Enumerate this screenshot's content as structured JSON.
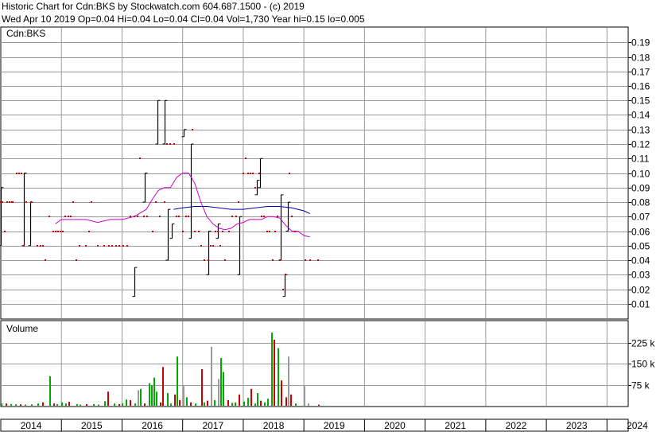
{
  "header": {
    "line1": "Historic Chart for Cdn:BKS by Stockwatch.com 604.687.1500 - (c) 2019",
    "line2": "Wed Apr 10 2019  Op=0.04  Hi=0.04  Lo=0.04  Cl=0.04  Vol=1,730  Year hi=0.15  lo=0.005"
  },
  "chart_data": [
    {
      "type": "ohlc",
      "title": "Cdn:BKS",
      "ylim": [
        0,
        0.2
      ],
      "y_ticks": [
        "0.19",
        "0.18",
        "0.17",
        "0.16",
        "0.15",
        "0.14",
        "0.13",
        "0.12",
        "0.11",
        "0.10",
        "0.09",
        "0.08",
        "0.07",
        "0.06",
        "0.05",
        "0.04",
        "0.03",
        "0.02",
        "0.01"
      ],
      "grid": true,
      "colors": {
        "price": "#cc0000",
        "bar": "#000000",
        "ma_short": "#cc00cc",
        "ma_long": "#0000aa",
        "grid": "#999999"
      },
      "price_points": [
        [
          2014.0,
          0.08
        ],
        [
          2014.02,
          0.08
        ],
        [
          2014.06,
          0.06
        ],
        [
          2014.1,
          0.08
        ],
        [
          2014.14,
          0.08
        ],
        [
          2014.18,
          0.08
        ],
        [
          2014.2,
          0.08
        ],
        [
          2014.26,
          0.1
        ],
        [
          2014.3,
          0.1
        ],
        [
          2014.34,
          0.1
        ],
        [
          2014.38,
          0.05
        ],
        [
          2014.42,
          0.08
        ],
        [
          2014.5,
          0.08
        ],
        [
          2014.6,
          0.05
        ],
        [
          2014.66,
          0.05
        ],
        [
          2014.7,
          0.05
        ],
        [
          2014.74,
          0.04
        ],
        [
          2014.8,
          0.07
        ],
        [
          2014.86,
          0.06
        ],
        [
          2014.9,
          0.06
        ],
        [
          2014.94,
          0.06
        ],
        [
          2014.98,
          0.06
        ],
        [
          2015.02,
          0.06
        ],
        [
          2015.06,
          0.07
        ],
        [
          2015.12,
          0.07
        ],
        [
          2015.16,
          0.07
        ],
        [
          2015.2,
          0.08
        ],
        [
          2015.24,
          0.04
        ],
        [
          2015.3,
          0.05
        ],
        [
          2015.4,
          0.05
        ],
        [
          2015.46,
          0.06
        ],
        [
          2015.5,
          0.08
        ],
        [
          2015.6,
          0.05
        ],
        [
          2015.7,
          0.05
        ],
        [
          2015.78,
          0.05
        ],
        [
          2015.84,
          0.05
        ],
        [
          2015.9,
          0.05
        ],
        [
          2015.96,
          0.05
        ],
        [
          2016.02,
          0.05
        ],
        [
          2016.08,
          0.05
        ],
        [
          2016.14,
          0.07
        ],
        [
          2016.2,
          0.07
        ],
        [
          2016.26,
          0.07
        ],
        [
          2016.3,
          0.11
        ],
        [
          2016.36,
          0.07
        ],
        [
          2016.42,
          0.07
        ],
        [
          2016.5,
          0.06
        ],
        [
          2016.56,
          0.08
        ],
        [
          2016.62,
          0.07
        ],
        [
          2016.7,
          0.08
        ],
        [
          2016.74,
          0.12
        ],
        [
          2016.8,
          0.12
        ],
        [
          2016.86,
          0.12
        ],
        [
          2016.9,
          0.07
        ],
        [
          2016.94,
          0.07
        ],
        [
          2017.0,
          0.06
        ],
        [
          2017.06,
          0.07
        ],
        [
          2017.1,
          0.07
        ],
        [
          2017.16,
          0.13
        ],
        [
          2017.2,
          0.06
        ],
        [
          2017.26,
          0.06
        ],
        [
          2017.3,
          0.05
        ],
        [
          2017.36,
          0.04
        ],
        [
          2017.42,
          0.04
        ],
        [
          2017.46,
          0.05
        ],
        [
          2017.5,
          0.05
        ],
        [
          2017.54,
          0.06
        ],
        [
          2017.58,
          0.06
        ],
        [
          2017.62,
          0.05
        ],
        [
          2017.66,
          0.06
        ],
        [
          2017.7,
          0.04
        ],
        [
          2017.76,
          0.06
        ],
        [
          2017.82,
          0.07
        ],
        [
          2017.88,
          0.07
        ],
        [
          2017.92,
          0.08
        ],
        [
          2018.0,
          0.1
        ],
        [
          2018.04,
          0.11
        ],
        [
          2018.08,
          0.1
        ],
        [
          2018.12,
          0.1
        ],
        [
          2018.16,
          0.1
        ],
        [
          2018.2,
          0.09
        ],
        [
          2018.26,
          0.1
        ],
        [
          2018.3,
          0.07
        ],
        [
          2018.34,
          0.07
        ],
        [
          2018.4,
          0.06
        ],
        [
          2018.44,
          0.06
        ],
        [
          2018.48,
          0.04
        ],
        [
          2018.52,
          0.06
        ],
        [
          2018.56,
          0.07
        ],
        [
          2018.6,
          0.04
        ],
        [
          2018.66,
          0.02
        ],
        [
          2018.7,
          0.03
        ],
        [
          2018.76,
          0.1
        ],
        [
          2018.8,
          0.07
        ],
        [
          2018.86,
          0.06
        ],
        [
          2019.02,
          0.04
        ],
        [
          2019.1,
          0.04
        ],
        [
          2019.24,
          0.04
        ]
      ],
      "bars": [
        [
          2014.0,
          0.05,
          0.09
        ],
        [
          2014.38,
          0.05,
          0.1
        ],
        [
          2014.48,
          0.05,
          0.08
        ],
        [
          2016.2,
          0.015,
          0.035
        ],
        [
          2016.38,
          0.08,
          0.1
        ],
        [
          2016.58,
          0.12,
          0.15
        ],
        [
          2016.7,
          0.12,
          0.15
        ],
        [
          2016.76,
          0.04,
          0.075
        ],
        [
          2016.82,
          0.055,
          0.065
        ],
        [
          2017.02,
          0.125,
          0.13
        ],
        [
          2017.14,
          0.055,
          0.12
        ],
        [
          2017.42,
          0.03,
          0.06
        ],
        [
          2017.58,
          0.055,
          0.065
        ],
        [
          2017.94,
          0.03,
          0.07
        ],
        [
          2018.22,
          0.085,
          0.095
        ],
        [
          2018.28,
          0.09,
          0.11
        ],
        [
          2018.62,
          0.04,
          0.085
        ],
        [
          2018.68,
          0.015,
          0.03
        ],
        [
          2018.74,
          0.06,
          0.08
        ]
      ],
      "ma_short": [
        [
          2014.9,
          0.065
        ],
        [
          2015.0,
          0.068
        ],
        [
          2015.2,
          0.068
        ],
        [
          2015.4,
          0.068
        ],
        [
          2015.6,
          0.066
        ],
        [
          2015.8,
          0.068
        ],
        [
          2016.0,
          0.068
        ],
        [
          2016.2,
          0.07
        ],
        [
          2016.4,
          0.075
        ],
        [
          2016.5,
          0.082
        ],
        [
          2016.6,
          0.088
        ],
        [
          2016.7,
          0.09
        ],
        [
          2016.8,
          0.09
        ],
        [
          2016.9,
          0.097
        ],
        [
          2017.0,
          0.1
        ],
        [
          2017.1,
          0.1
        ],
        [
          2017.2,
          0.093
        ],
        [
          2017.3,
          0.08
        ],
        [
          2017.4,
          0.07
        ],
        [
          2017.5,
          0.065
        ],
        [
          2017.6,
          0.062
        ],
        [
          2017.7,
          0.061
        ],
        [
          2017.8,
          0.062
        ],
        [
          2017.9,
          0.065
        ],
        [
          2018.0,
          0.066
        ],
        [
          2018.1,
          0.068
        ],
        [
          2018.2,
          0.068
        ],
        [
          2018.3,
          0.068
        ],
        [
          2018.4,
          0.07
        ],
        [
          2018.5,
          0.07
        ],
        [
          2018.6,
          0.069
        ],
        [
          2018.7,
          0.064
        ],
        [
          2018.8,
          0.06
        ],
        [
          2018.9,
          0.06
        ],
        [
          2019.0,
          0.057
        ],
        [
          2019.1,
          0.056
        ]
      ],
      "ma_long": [
        [
          2016.85,
          0.075
        ],
        [
          2017.0,
          0.076
        ],
        [
          2017.2,
          0.077
        ],
        [
          2017.4,
          0.077
        ],
        [
          2017.6,
          0.076
        ],
        [
          2017.8,
          0.075
        ],
        [
          2018.0,
          0.075
        ],
        [
          2018.2,
          0.076
        ],
        [
          2018.4,
          0.077
        ],
        [
          2018.6,
          0.077
        ],
        [
          2018.8,
          0.076
        ],
        [
          2019.0,
          0.074
        ],
        [
          2019.1,
          0.072
        ]
      ]
    },
    {
      "type": "bar",
      "title": "Volume",
      "ylim": [
        0,
        300
      ],
      "y_ticks": [
        "225 k",
        "150 k",
        "75 k"
      ],
      "y_tick_values": [
        225,
        150,
        75
      ],
      "grid": true,
      "colors": {
        "up": "#00aa00",
        "down": "#cc0000",
        "flat": "#999999"
      },
      "bars": [
        [
          2014.0,
          8,
          "up"
        ],
        [
          2014.08,
          8,
          "down"
        ],
        [
          2014.16,
          6,
          "up"
        ],
        [
          2014.24,
          5,
          "up"
        ],
        [
          2014.32,
          5,
          "down"
        ],
        [
          2014.4,
          4,
          "up"
        ],
        [
          2014.5,
          5,
          "up"
        ],
        [
          2014.6,
          8,
          "up"
        ],
        [
          2014.68,
          12,
          "down"
        ],
        [
          2014.8,
          105,
          "up"
        ],
        [
          2014.86,
          8,
          "down"
        ],
        [
          2014.92,
          6,
          "up"
        ],
        [
          2015.0,
          12,
          "up"
        ],
        [
          2015.06,
          8,
          "up"
        ],
        [
          2015.12,
          14,
          "down"
        ],
        [
          2015.24,
          6,
          "up"
        ],
        [
          2015.3,
          4,
          "up"
        ],
        [
          2015.4,
          6,
          "down"
        ],
        [
          2015.52,
          6,
          "up"
        ],
        [
          2015.6,
          4,
          "up"
        ],
        [
          2015.7,
          16,
          "up"
        ],
        [
          2015.76,
          50,
          "down"
        ],
        [
          2015.86,
          8,
          "up"
        ],
        [
          2015.94,
          6,
          "down"
        ],
        [
          2016.0,
          8,
          "up"
        ],
        [
          2016.06,
          22,
          "up"
        ],
        [
          2016.12,
          20,
          "down"
        ],
        [
          2016.2,
          8,
          "up"
        ],
        [
          2016.26,
          55,
          "flat"
        ],
        [
          2016.3,
          60,
          "up"
        ],
        [
          2016.36,
          8,
          "down"
        ],
        [
          2016.44,
          80,
          "up"
        ],
        [
          2016.48,
          72,
          "up"
        ],
        [
          2016.52,
          100,
          "up"
        ],
        [
          2016.56,
          50,
          "up"
        ],
        [
          2016.62,
          12,
          "down"
        ],
        [
          2016.66,
          138,
          "down"
        ],
        [
          2016.74,
          45,
          "up"
        ],
        [
          2016.8,
          8,
          "up"
        ],
        [
          2016.86,
          40,
          "down"
        ],
        [
          2016.9,
          175,
          "up"
        ],
        [
          2016.94,
          20,
          "down"
        ],
        [
          2017.0,
          70,
          "flat"
        ],
        [
          2017.06,
          30,
          "up"
        ],
        [
          2017.12,
          12,
          "down"
        ],
        [
          2017.2,
          8,
          "up"
        ],
        [
          2017.3,
          130,
          "down"
        ],
        [
          2017.34,
          12,
          "up"
        ],
        [
          2017.4,
          18,
          "down"
        ],
        [
          2017.46,
          210,
          "flat"
        ],
        [
          2017.52,
          20,
          "up"
        ],
        [
          2017.58,
          95,
          "flat"
        ],
        [
          2017.62,
          170,
          "up"
        ],
        [
          2017.66,
          120,
          "up"
        ],
        [
          2017.74,
          20,
          "down"
        ],
        [
          2017.8,
          10,
          "up"
        ],
        [
          2017.86,
          12,
          "up"
        ],
        [
          2017.92,
          40,
          "down"
        ],
        [
          2018.0,
          15,
          "up"
        ],
        [
          2018.06,
          28,
          "up"
        ],
        [
          2018.12,
          60,
          "down"
        ],
        [
          2018.18,
          8,
          "up"
        ],
        [
          2018.22,
          45,
          "up"
        ],
        [
          2018.28,
          18,
          "down"
        ],
        [
          2018.34,
          12,
          "up"
        ],
        [
          2018.4,
          25,
          "up"
        ],
        [
          2018.46,
          260,
          "up"
        ],
        [
          2018.5,
          235,
          "down"
        ],
        [
          2018.56,
          205,
          "up"
        ],
        [
          2018.62,
          90,
          "down"
        ],
        [
          2018.7,
          30,
          "down"
        ],
        [
          2018.74,
          175,
          "flat"
        ],
        [
          2018.78,
          40,
          "down"
        ],
        [
          2018.86,
          8,
          "up"
        ],
        [
          2019.0,
          70,
          "flat"
        ],
        [
          2019.06,
          8,
          "flat"
        ],
        [
          2019.24,
          4,
          "down"
        ]
      ]
    }
  ],
  "x_axis": {
    "labels": [
      "2014",
      "2015",
      "2016",
      "2017",
      "2018",
      "2019",
      "2020",
      "2021",
      "2022",
      "2023",
      "2024"
    ],
    "years": [
      2014,
      2015,
      2016,
      2017,
      2018,
      2019,
      2020,
      2021,
      2022,
      2023,
      2024
    ]
  }
}
